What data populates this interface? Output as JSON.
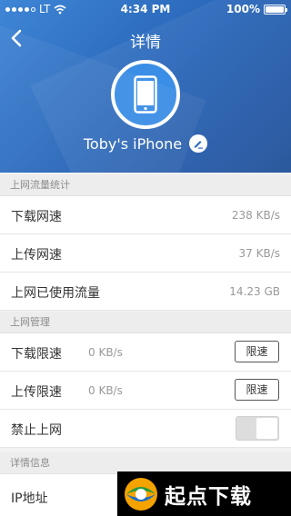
{
  "status_bar": {
    "carrier": "LT",
    "time": "4:34 PM",
    "battery": "100%"
  },
  "nav": {
    "title": "详情"
  },
  "device": {
    "name": "Toby's iPhone"
  },
  "sections": {
    "traffic": {
      "header": "上网流量统计",
      "rows": [
        {
          "label": "下载网速",
          "value": "238 KB/s"
        },
        {
          "label": "上传网速",
          "value": "37 KB/s"
        },
        {
          "label": "上网已使用流量",
          "value": "14.23 GB"
        }
      ]
    },
    "management": {
      "header": "上网管理",
      "download": {
        "label": "下载限速",
        "value": "0 KB/s",
        "button": "限速"
      },
      "upload": {
        "label": "上传限速",
        "value": "0 KB/s",
        "button": "限速"
      },
      "block": {
        "label": "禁止上网"
      }
    },
    "details": {
      "header": "详情信息",
      "ip_label": "IP地址"
    }
  },
  "watermark": {
    "text": "起点下载"
  },
  "colors": {
    "header_blue": "#2a6bc0",
    "accent": "#3a8ee6"
  }
}
